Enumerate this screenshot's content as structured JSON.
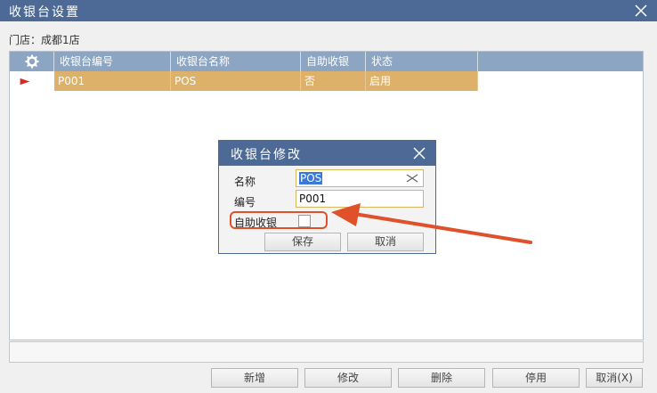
{
  "window": {
    "title": "收银台设置"
  },
  "store": {
    "label": "门店：",
    "name": "成都1店"
  },
  "table": {
    "columns": [
      "收银台编号",
      "收银台名称",
      "自助收银",
      "状态"
    ],
    "rows": [
      {
        "code": "P001",
        "name": "POS",
        "self_service": "否",
        "status": "启用"
      }
    ]
  },
  "dialog": {
    "title": "收银台修改",
    "name_label": "名称",
    "name_value": "POS",
    "code_label": "编号",
    "code_value": "P001",
    "self_service_label": "自助收银",
    "self_service_checked": false,
    "save_label": "保存",
    "cancel_label": "取消"
  },
  "footer": {
    "add_label": "新增",
    "edit_label": "修改",
    "delete_label": "删除",
    "disable_label": "停用",
    "cancel_label": "取消(X)"
  },
  "colors": {
    "titlebar": "#4c6a95",
    "header": "#8ba5c3",
    "selected_row": "#ddb169",
    "annotation": "#e0502a"
  }
}
